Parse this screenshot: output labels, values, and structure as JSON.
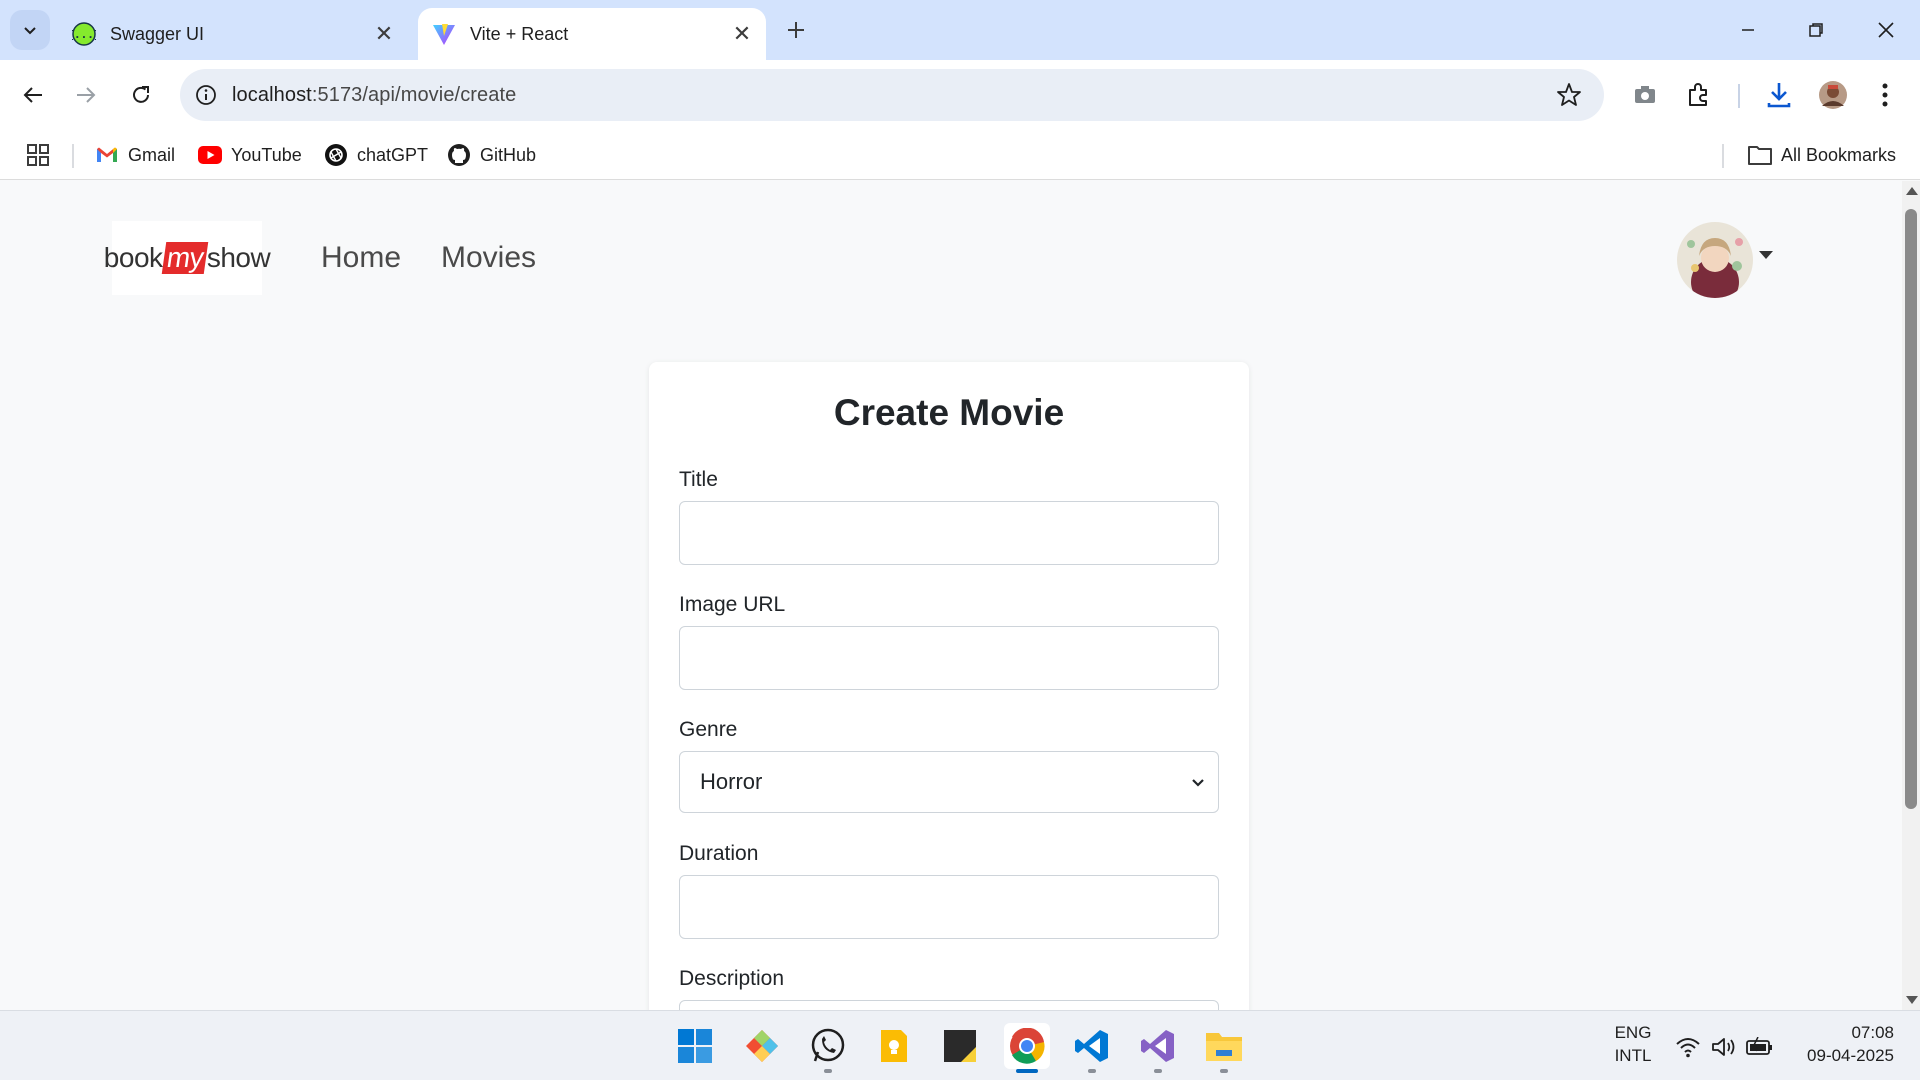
{
  "browser": {
    "tabs": [
      {
        "title": "Swagger UI",
        "active": false,
        "favicon": "swagger-icon"
      },
      {
        "title": "Vite + React",
        "active": true,
        "favicon": "vite-icon"
      }
    ],
    "url_host": "localhost",
    "url_path": ":5173/api/movie/create",
    "bookmarks": [
      {
        "label": "Gmail",
        "icon": "gmail-icon"
      },
      {
        "label": "YouTube",
        "icon": "youtube-icon"
      },
      {
        "label": "chatGPT",
        "icon": "chatgpt-icon"
      },
      {
        "label": "GitHub",
        "icon": "github-icon"
      }
    ],
    "all_bookmarks_label": "All Bookmarks"
  },
  "app": {
    "logo": {
      "part1": "book",
      "part2": "my",
      "part3": "show"
    },
    "nav": [
      {
        "label": "Home"
      },
      {
        "label": "Movies"
      }
    ],
    "brand_color": "#e42b2b"
  },
  "form": {
    "heading": "Create Movie",
    "title_label": "Title",
    "title_value": "",
    "image_url_label": "Image URL",
    "image_url_value": "",
    "genre_label": "Genre",
    "genre_value": "Horror",
    "duration_label": "Duration",
    "duration_value": "",
    "description_label": "Description"
  },
  "taskbar": {
    "apps": [
      "windows-start-icon",
      "git-icon",
      "whatsapp-icon",
      "keep-icon",
      "sticky-notes-icon",
      "chrome-icon",
      "vscode-icon",
      "visual-studio-icon",
      "file-explorer-icon"
    ],
    "lang_line1": "ENG",
    "lang_line2": "INTL",
    "time": "07:08",
    "date": "09-04-2025"
  }
}
